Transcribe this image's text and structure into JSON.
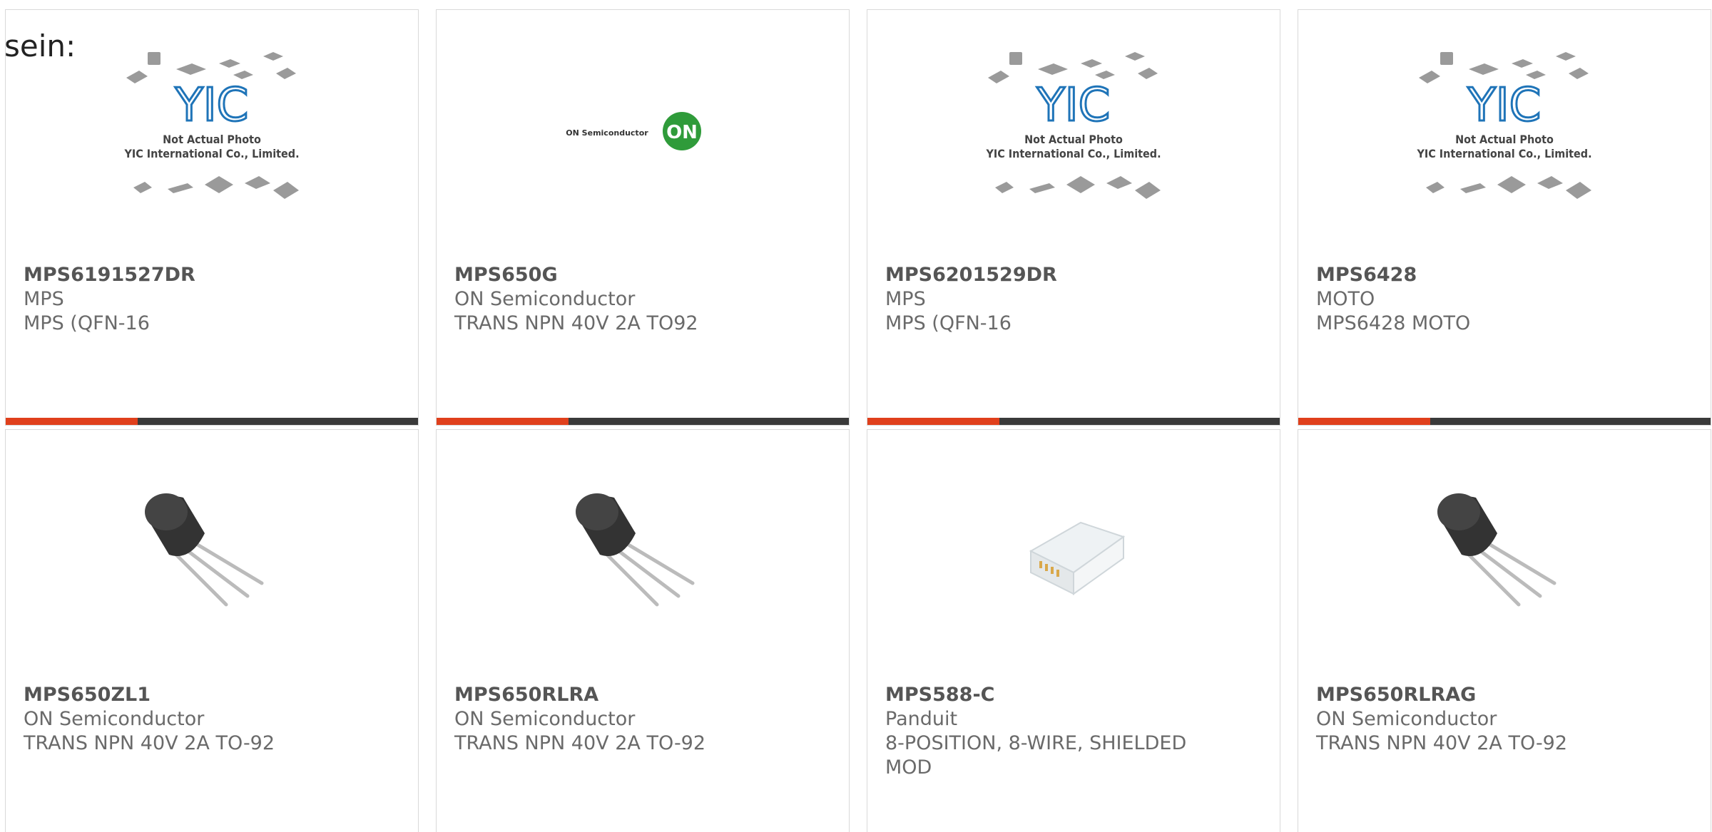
{
  "intro_text": "sein:",
  "colors": {
    "accent": "#e0401c",
    "bar": "#3a3a3a",
    "text": "#555555",
    "on_logo": "#2f9b3a"
  },
  "yic_placeholder": {
    "logo_text": "YIC",
    "line1": "Not Actual Photo",
    "line2": "YIC International Co., Limited."
  },
  "on_logo": {
    "wordmark": "ON Semiconductor",
    "badge": "ON"
  },
  "products": [
    {
      "part": "MPS6191527DR",
      "manufacturer": "MPS",
      "description": "MPS (QFN-16",
      "image": "yic-placeholder",
      "accent_level": 0.32
    },
    {
      "part": "MPS650G",
      "manufacturer": "ON Semiconductor",
      "description": "TRANS NPN 40V 2A TO92",
      "image": "on-semiconductor-logo",
      "accent_level": 0.32
    },
    {
      "part": "MPS6201529DR",
      "manufacturer": "MPS",
      "description": "MPS (QFN-16",
      "image": "yic-placeholder",
      "accent_level": 0.32
    },
    {
      "part": "MPS6428",
      "manufacturer": "MOTO",
      "description": "MPS6428 MOTO",
      "image": "yic-placeholder",
      "accent_level": 0.32
    },
    {
      "part": "MPS650ZL1",
      "manufacturer": "ON Semiconductor",
      "description": "TRANS NPN 40V 2A TO-92",
      "image": "to92-transistor",
      "accent_level": 0.32
    },
    {
      "part": "MPS650RLRA",
      "manufacturer": "ON Semiconductor",
      "description": "TRANS NPN 40V 2A TO-92",
      "image": "to92-transistor",
      "accent_level": 0.32
    },
    {
      "part": "MPS588-C",
      "manufacturer": "Panduit",
      "description": "8-POSITION, 8-WIRE, SHIELDED MOD",
      "image": "rj45-plug",
      "accent_level": 0.32
    },
    {
      "part": "MPS650RLRAG",
      "manufacturer": "ON Semiconductor",
      "description": "TRANS NPN 40V 2A TO-92",
      "image": "to92-transistor",
      "accent_level": 0.32
    }
  ]
}
